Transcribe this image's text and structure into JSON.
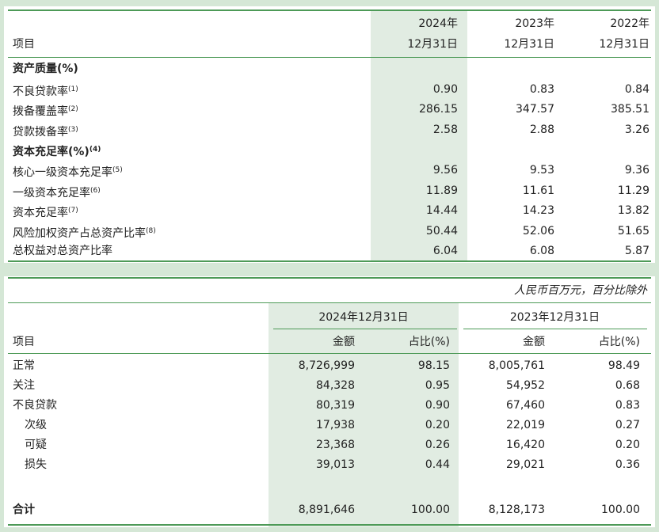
{
  "table1": {
    "header": {
      "item_label": "项目",
      "cols": [
        {
          "year": "2024年",
          "date": "12月31日"
        },
        {
          "year": "2023年",
          "date": "12月31日"
        },
        {
          "year": "2022年",
          "date": "12月31日"
        }
      ]
    },
    "rows": [
      {
        "label": "资产质量(%)",
        "sup": "",
        "bold": true,
        "values": [
          "",
          "",
          ""
        ]
      },
      {
        "label": "不良贷款率",
        "sup": "(1)",
        "bold": false,
        "values": [
          "0.90",
          "0.83",
          "0.84"
        ]
      },
      {
        "label": "拨备覆盖率",
        "sup": "(2)",
        "bold": false,
        "values": [
          "286.15",
          "347.57",
          "385.51"
        ]
      },
      {
        "label": "贷款拨备率",
        "sup": "(3)",
        "bold": false,
        "values": [
          "2.58",
          "2.88",
          "3.26"
        ]
      },
      {
        "label": "资本充足率(%)",
        "sup": "(4)",
        "bold": true,
        "values": [
          "",
          "",
          ""
        ]
      },
      {
        "label": "核心一级资本充足率",
        "sup": "(5)",
        "bold": false,
        "values": [
          "9.56",
          "9.53",
          "9.36"
        ]
      },
      {
        "label": "一级资本充足率",
        "sup": "(6)",
        "bold": false,
        "values": [
          "11.89",
          "11.61",
          "11.29"
        ]
      },
      {
        "label": "资本充足率",
        "sup": "(7)",
        "bold": false,
        "values": [
          "14.44",
          "14.23",
          "13.82"
        ]
      },
      {
        "label": "风险加权资产占总资产比率",
        "sup": "(8)",
        "bold": false,
        "values": [
          "50.44",
          "52.06",
          "51.65"
        ]
      },
      {
        "label": "总权益对总资产比率",
        "sup": "",
        "bold": false,
        "values": [
          "6.04",
          "6.08",
          "5.87"
        ]
      }
    ]
  },
  "table2": {
    "unit_note": "人民币百万元，百分比除外",
    "header": {
      "item_label": "项目",
      "groups": [
        "2024年12月31日",
        "2023年12月31日"
      ],
      "cols": [
        "金额",
        "占比(%)",
        "金额",
        "占比(%)"
      ]
    },
    "rows": [
      {
        "label": "正常",
        "indent": false,
        "bold": false,
        "values": [
          "8,726,999",
          "98.15",
          "8,005,761",
          "98.49"
        ]
      },
      {
        "label": "关注",
        "indent": false,
        "bold": false,
        "values": [
          "84,328",
          "0.95",
          "54,952",
          "0.68"
        ]
      },
      {
        "label": "不良贷款",
        "indent": false,
        "bold": false,
        "values": [
          "80,319",
          "0.90",
          "67,460",
          "0.83"
        ]
      },
      {
        "label": "次级",
        "indent": true,
        "bold": false,
        "values": [
          "17,938",
          "0.20",
          "22,019",
          "0.27"
        ]
      },
      {
        "label": "可疑",
        "indent": true,
        "bold": false,
        "values": [
          "23,368",
          "0.26",
          "16,420",
          "0.20"
        ]
      },
      {
        "label": "损失",
        "indent": true,
        "bold": false,
        "values": [
          "39,013",
          "0.44",
          "29,021",
          "0.36"
        ]
      }
    ],
    "total": {
      "label": "合计",
      "values": [
        "8,891,646",
        "100.00",
        "8,128,173",
        "100.00"
      ]
    }
  }
}
